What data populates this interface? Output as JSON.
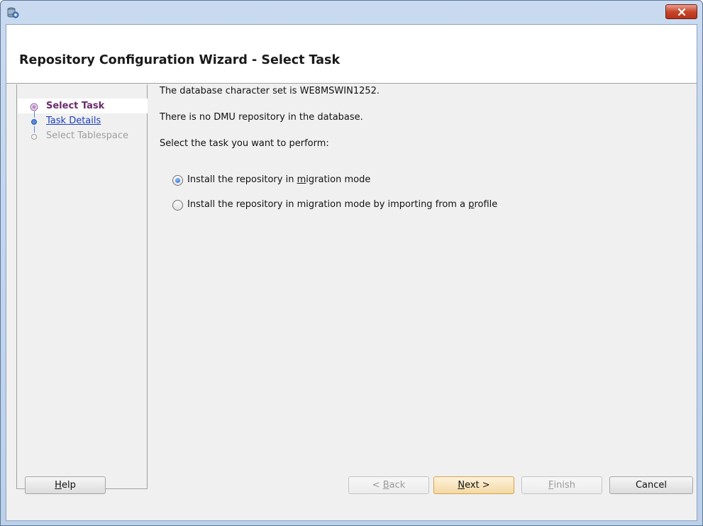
{
  "window": {
    "close_glyph": "✕"
  },
  "header": {
    "title": "Repository Configuration Wizard - Select Task"
  },
  "steps": [
    {
      "label": "Select Task",
      "state": "active"
    },
    {
      "label": "Task Details",
      "state": "link"
    },
    {
      "label": "Select Tablespace",
      "state": "disabled"
    }
  ],
  "main": {
    "charset_line": "The database character set is WE8MSWIN1252.",
    "repo_line": "There is no DMU repository in the database.",
    "prompt_line": "Select the task you want to perform:",
    "options": [
      {
        "pre": "Install the repository in ",
        "mnemonic": "m",
        "post": "igration mode",
        "checked": true
      },
      {
        "pre": "Install the repository in migration mode by importing from a ",
        "mnemonic": "p",
        "post": "rofile",
        "checked": false
      }
    ]
  },
  "buttons": {
    "help": {
      "mnemonic": "H",
      "rest": "elp"
    },
    "back": {
      "prefix": "< ",
      "mnemonic": "B",
      "rest": "ack"
    },
    "next": {
      "mnemonic": "N",
      "rest": "ext >"
    },
    "finish": {
      "mnemonic": "F",
      "rest": "inish"
    },
    "cancel": "Cancel"
  },
  "colors": {
    "active_step": "#6b2a6b",
    "link": "#1d3fbb",
    "titlebar": "#c9daf0",
    "close": "#c7462a"
  }
}
